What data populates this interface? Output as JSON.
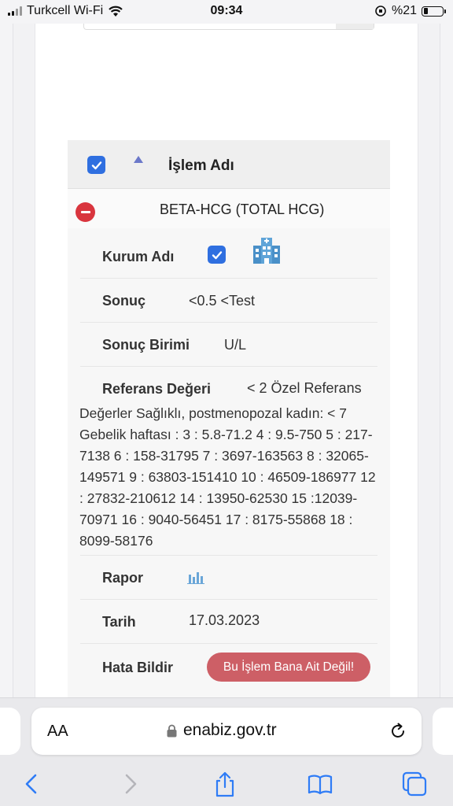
{
  "status_bar": {
    "carrier": "Turkcell Wi-Fi",
    "time": "09:34",
    "battery": "%21"
  },
  "table": {
    "header_title": "İşlem Adı",
    "test_name": "BETA-HCG (TOTAL HCG)",
    "fields": {
      "institution_label": "Kurum Adı",
      "result_label": "Sonuç",
      "result_value": "<0.5 <Test",
      "unit_label": "Sonuç Birimi",
      "unit_value": "U/L",
      "reference_label": "Referans Değeri",
      "reference_value_inline": "< 2 Özel Referans",
      "reference_value_rest": "Değerler Sağlıklı, postmenopozal kadın: < 7 Gebelik haftası : 3 : 5.8-71.2 4 : 9.5-750 5 : 217-7138 6 : 158-31795 7 : 3697-163563 8 : 32065-149571 9 : 63803-151410 10 : 46509-186977 12 : 27832-210612 14 : 13950-62530 15 :12039-70971 16 : 9040-56451 17 : 8175-55868 18 : 8099-58176",
      "report_label": "Rapor",
      "date_label": "Tarih",
      "date_value": "17.03.2023",
      "error_label": "Hata Bildir",
      "error_button": "Bu İşlem Bana Ait Değil!"
    }
  },
  "browser": {
    "text_size_label": "AA",
    "url": "enabiz.gov.tr"
  },
  "icons": {
    "checkbox": "checkbox-checked-icon",
    "sort": "sort-ascending-icon",
    "collapse": "minus-circle-icon",
    "hospital": "hospital-icon",
    "report": "bar-chart-icon",
    "lock": "lock-icon",
    "reload": "reload-icon",
    "back": "chevron-left-icon",
    "forward": "chevron-right-icon",
    "share": "share-icon",
    "bookmarks": "book-icon",
    "tabs": "tabs-icon"
  },
  "colors": {
    "checkbox_blue": "#2f6fe0",
    "collapse_red": "#d9353e",
    "error_button": "#cd5f66",
    "safari_blue": "#2f7cf6"
  }
}
